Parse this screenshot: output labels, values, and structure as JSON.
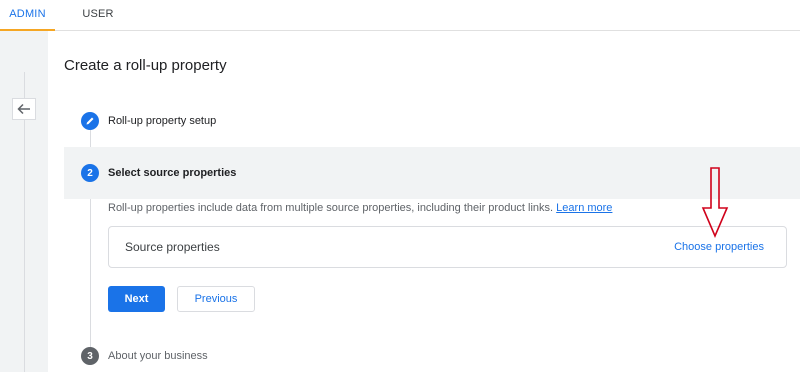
{
  "tabs": {
    "admin": "ADMIN",
    "user": "USER"
  },
  "page": {
    "title": "Create a roll-up property"
  },
  "steps": [
    {
      "number": "1",
      "label": "Roll-up property setup",
      "status": "completed"
    },
    {
      "number": "2",
      "label": "Select source properties",
      "status": "active"
    },
    {
      "number": "3",
      "label": "About your business",
      "status": "pending"
    }
  ],
  "step2": {
    "description": "Roll-up properties include data from multiple source properties, including their product links.",
    "learn_more": "Learn more",
    "source_label": "Source properties",
    "choose_link": "Choose properties"
  },
  "buttons": {
    "next": "Next",
    "previous": "Previous"
  },
  "colors": {
    "accent": "#1a73e8",
    "tab_indicator": "#f5a623",
    "annotation": "#d0021b"
  },
  "icons": {
    "back": "arrow-left-icon",
    "completed_step": "pencil-icon",
    "annotation": "down-arrow-annotation"
  }
}
